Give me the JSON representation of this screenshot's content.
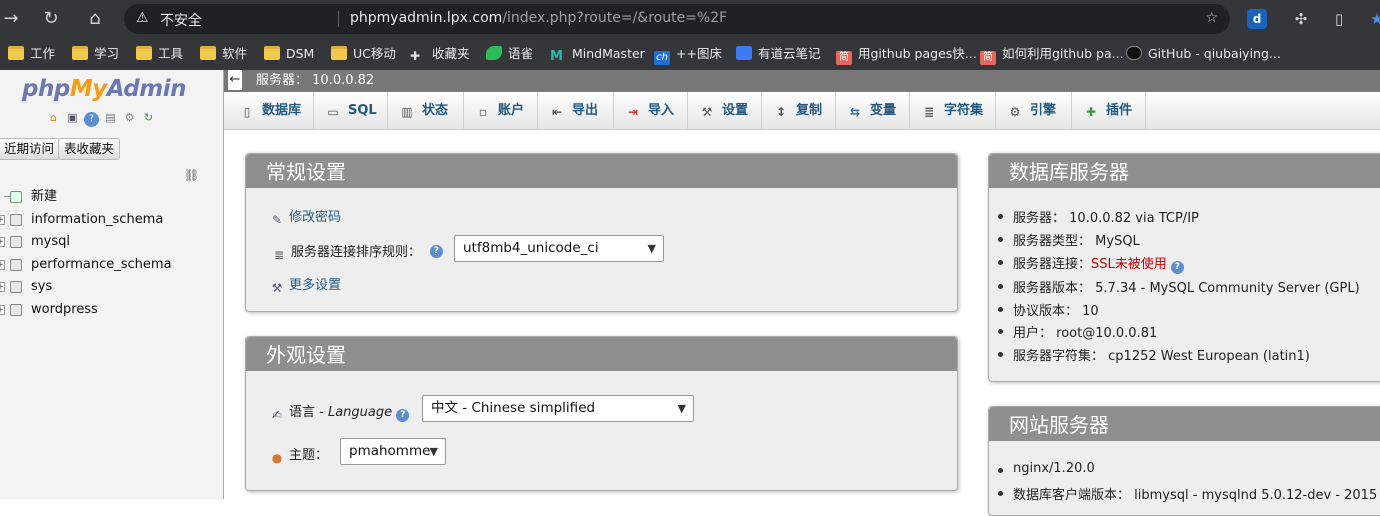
{
  "browser": {
    "insecure_label": "不安全",
    "url_host": "phpmyadmin.lpx.com",
    "url_path": "/index.php?route=/&route=%2F",
    "bookmarks": [
      {
        "label": "工作",
        "icon": "folder-icon"
      },
      {
        "label": "学习",
        "icon": "folder-icon"
      },
      {
        "label": "工具",
        "icon": "folder-icon"
      },
      {
        "label": "软件",
        "icon": "folder-icon"
      },
      {
        "label": "DSM",
        "icon": "folder-icon"
      },
      {
        "label": "UC移动",
        "icon": "folder-icon"
      },
      {
        "label": "收藏夹",
        "icon": "star-icon"
      },
      {
        "label": "语雀",
        "icon": "yuque-icon"
      },
      {
        "label": "MindMaster",
        "icon": "mindmaster-icon"
      },
      {
        "label": "++图床",
        "icon": "ch-icon"
      },
      {
        "label": "有道云笔记",
        "icon": "youdao-icon"
      },
      {
        "label": "用github pages快...",
        "icon": "jian-icon"
      },
      {
        "label": "如何利用github pa...",
        "icon": "jian-icon"
      },
      {
        "label": "GitHub - qiubaiying...",
        "icon": "github-icon"
      }
    ]
  },
  "sidebar": {
    "logo_php": "php",
    "logo_my": "My",
    "logo_admin": "Admin",
    "btn_recent": "近期访问",
    "btn_favorites": "表收藏夹",
    "new_label": "新建",
    "databases": [
      "information_schema",
      "mysql",
      "performance_schema",
      "sys",
      "wordpress"
    ]
  },
  "serverbar": {
    "label": "服务器：",
    "address": "10.0.0.82"
  },
  "tabs": [
    {
      "label": "数据库",
      "icon": "database-icon"
    },
    {
      "label": "SQL",
      "icon": "sql-icon"
    },
    {
      "label": "状态",
      "icon": "status-icon"
    },
    {
      "label": "账户",
      "icon": "accounts-icon"
    },
    {
      "label": "导出",
      "icon": "export-icon"
    },
    {
      "label": "导入",
      "icon": "import-icon"
    },
    {
      "label": "设置",
      "icon": "settings-icon"
    },
    {
      "label": "复制",
      "icon": "replication-icon"
    },
    {
      "label": "变量",
      "icon": "variables-icon"
    },
    {
      "label": "字符集",
      "icon": "charset-icon"
    },
    {
      "label": "引擎",
      "icon": "engine-icon"
    },
    {
      "label": "插件",
      "icon": "plugin-icon"
    }
  ],
  "general": {
    "title": "常规设置",
    "change_password": "修改密码",
    "collation_label": "服务器连接排序规则：",
    "collation_value": "utf8mb4_unicode_ci",
    "more_settings": "更多设置"
  },
  "appearance": {
    "title": "外观设置",
    "language_label": "语言 - ",
    "language_en": "Language",
    "language_value": "中文 - Chinese simplified",
    "theme_label": "主题：",
    "theme_value": "pmahomme"
  },
  "db_server": {
    "title": "数据库服务器",
    "items": [
      {
        "label": "服务器：",
        "value": "10.0.0.82 via TCP/IP"
      },
      {
        "label": "服务器类型：",
        "value": "MySQL"
      },
      {
        "label": "服务器连接：",
        "value": "SSL未被使用"
      },
      {
        "label": "服务器版本：",
        "value": "5.7.34 - MySQL Community Server (GPL)"
      },
      {
        "label": "协议版本：",
        "value": "10"
      },
      {
        "label": "用户：",
        "value": "root@10.0.0.81"
      },
      {
        "label": "服务器字符集：",
        "value": "cp1252 West European (latin1)"
      }
    ]
  },
  "web_server": {
    "title": "网站服务器",
    "items": [
      {
        "label": "",
        "value": "nginx/1.20.0"
      },
      {
        "label": "数据库客户端版本：",
        "value": "libmysql - mysqlnd 5.0.12-dev - 2015"
      }
    ]
  }
}
